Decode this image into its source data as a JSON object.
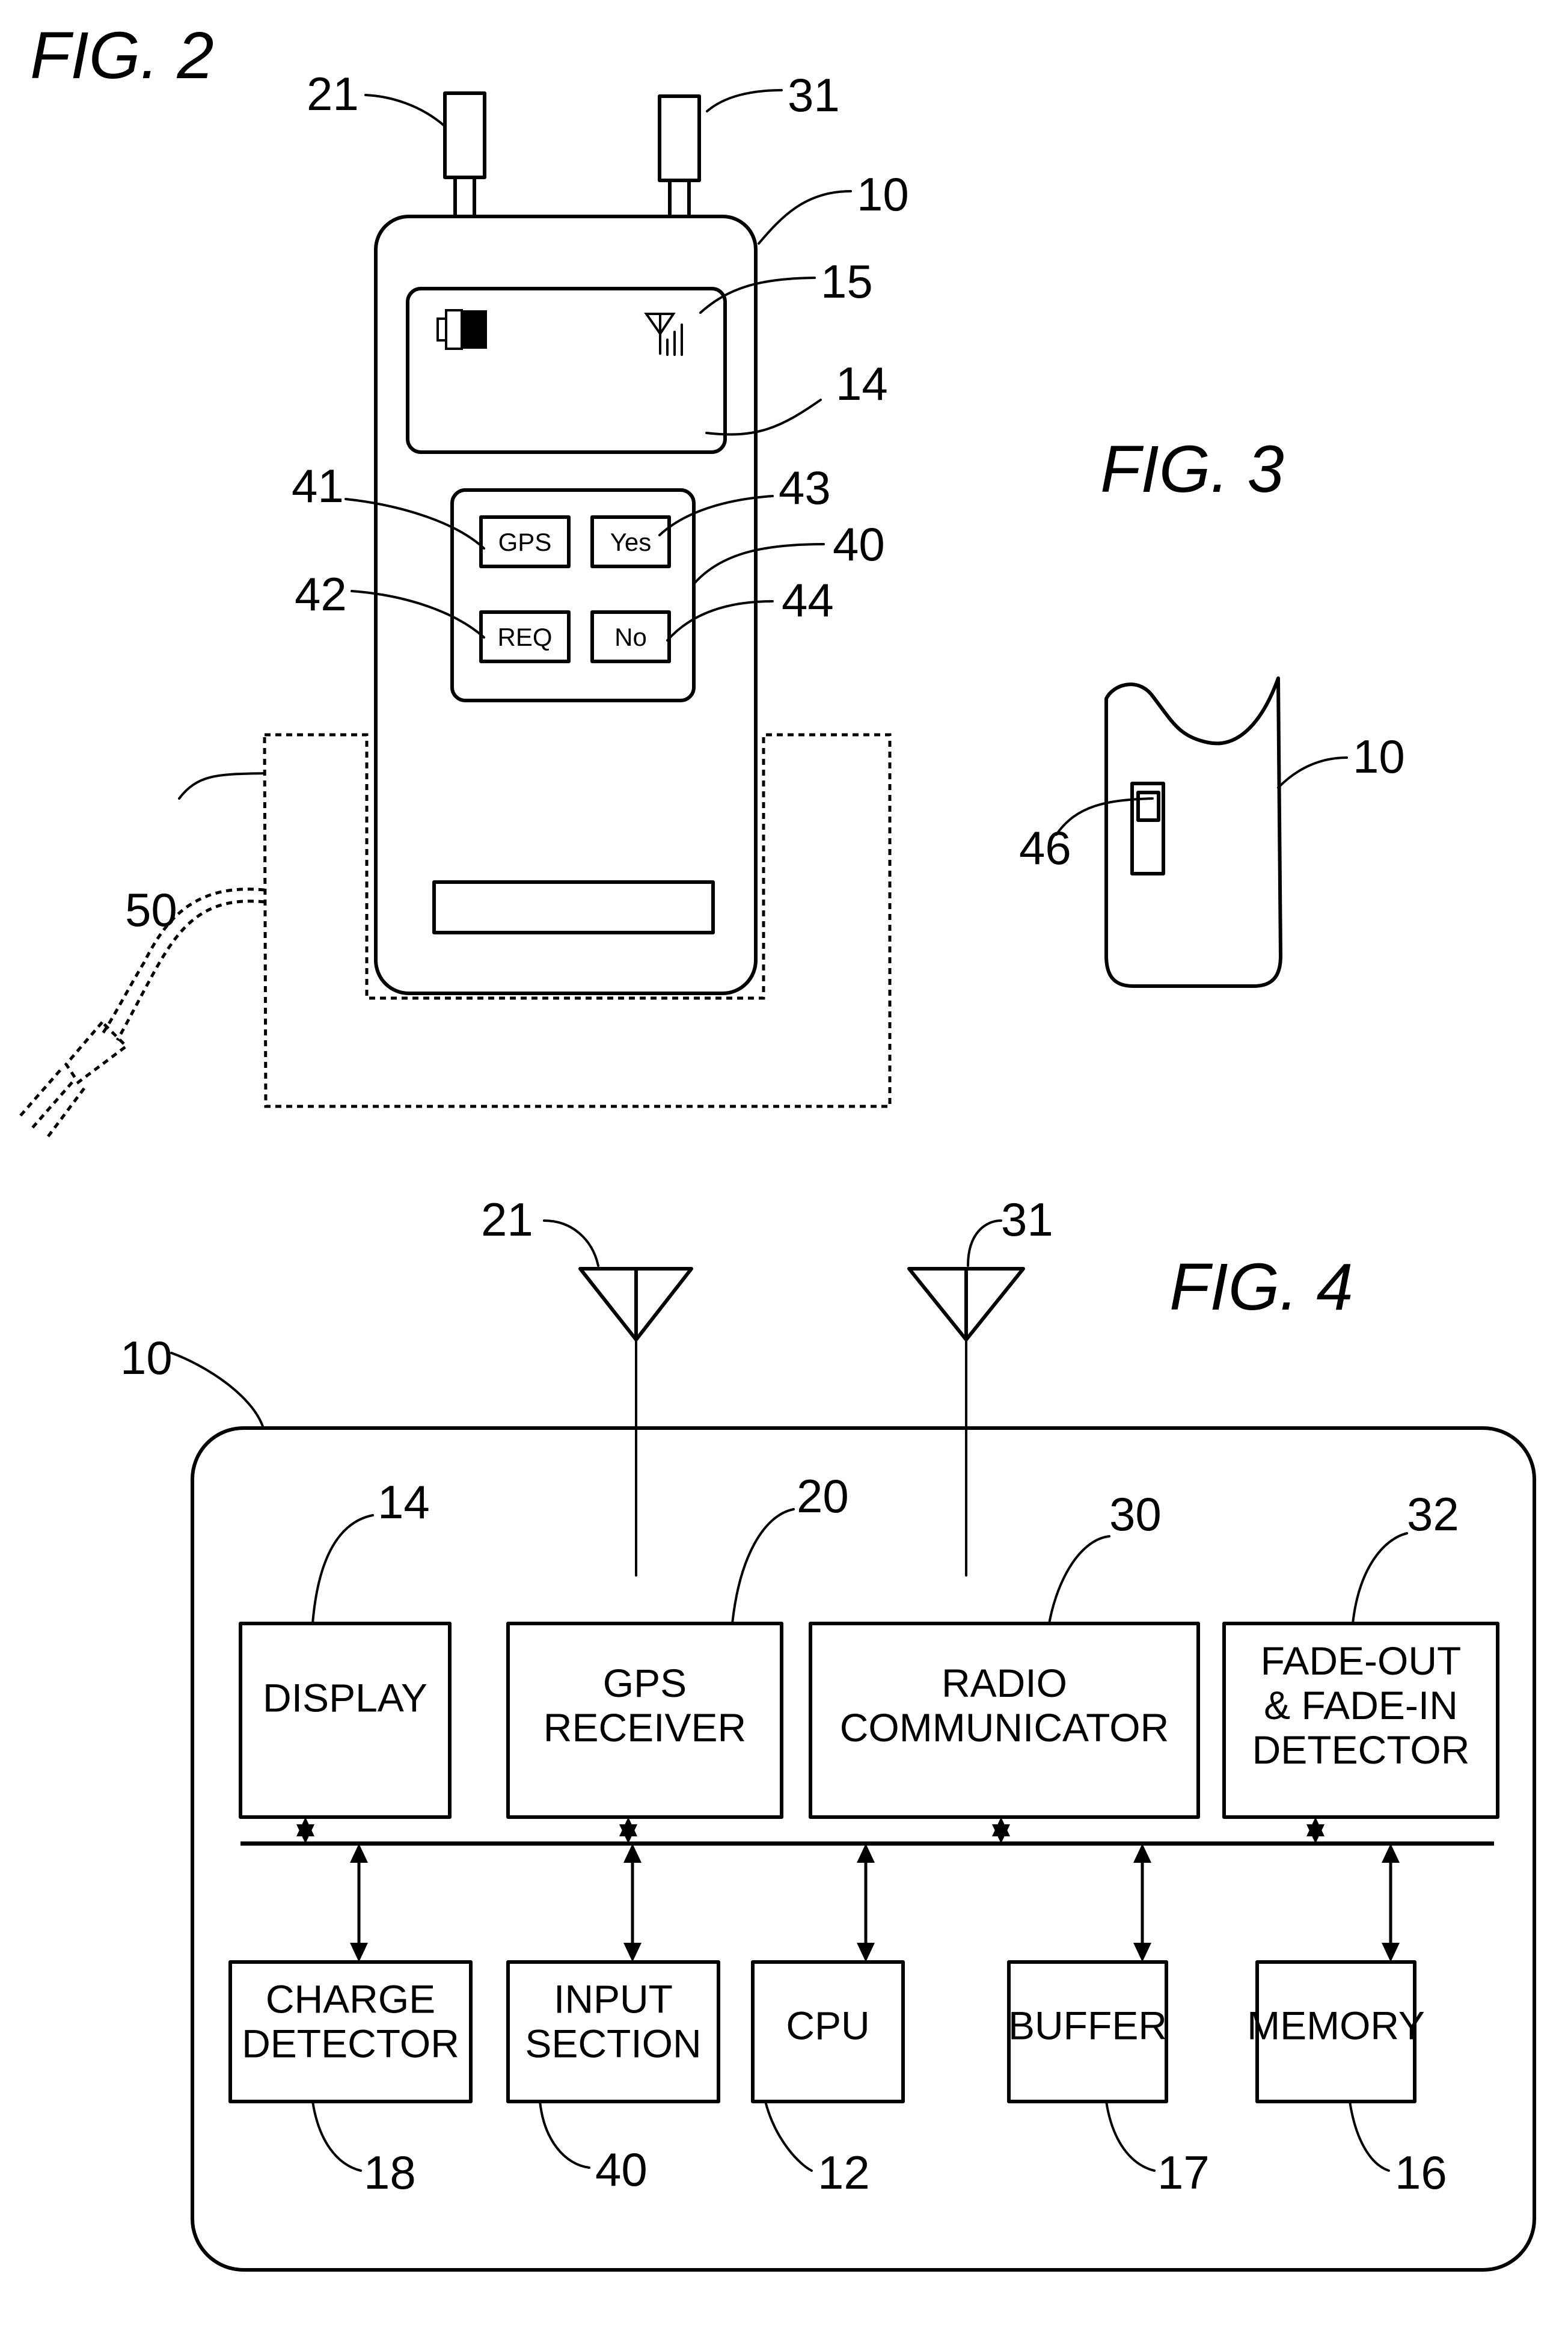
{
  "figures": {
    "fig2": {
      "title": "FIG. 2",
      "refs": {
        "antenna_gps": "21",
        "antenna_radio": "31",
        "device": "10",
        "indicator": "15",
        "display": "14",
        "key_gps": "41",
        "key_yes": "43",
        "input_section": "40",
        "key_req": "42",
        "key_no": "44",
        "cradle": "50"
      },
      "buttons": {
        "gps": "GPS",
        "yes": "Yes",
        "req": "REQ",
        "no": "No"
      }
    },
    "fig3": {
      "title": "FIG. 3",
      "refs": {
        "device": "10",
        "switch": "46"
      }
    },
    "fig4": {
      "title": "FIG. 4",
      "refs": {
        "device": "10",
        "antenna_gps": "21",
        "antenna_radio": "31"
      },
      "top_blocks": [
        {
          "ref": "14",
          "lines": [
            "DISPLAY"
          ]
        },
        {
          "ref": "20",
          "lines": [
            "GPS",
            "RECEIVER"
          ]
        },
        {
          "ref": "30",
          "lines": [
            "RADIO",
            "COMMUNICATOR"
          ]
        },
        {
          "ref": "32",
          "lines": [
            "FADE-OUT",
            "& FADE-IN",
            "DETECTOR"
          ]
        }
      ],
      "bottom_blocks": [
        {
          "ref": "18",
          "lines": [
            "CHARGE",
            "DETECTOR"
          ]
        },
        {
          "ref": "40",
          "lines": [
            "INPUT",
            "SECTION"
          ]
        },
        {
          "ref": "12",
          "lines": [
            "CPU"
          ]
        },
        {
          "ref": "17",
          "lines": [
            "BUFFER"
          ]
        },
        {
          "ref": "16",
          "lines": [
            "MEMORY"
          ]
        }
      ]
    }
  }
}
